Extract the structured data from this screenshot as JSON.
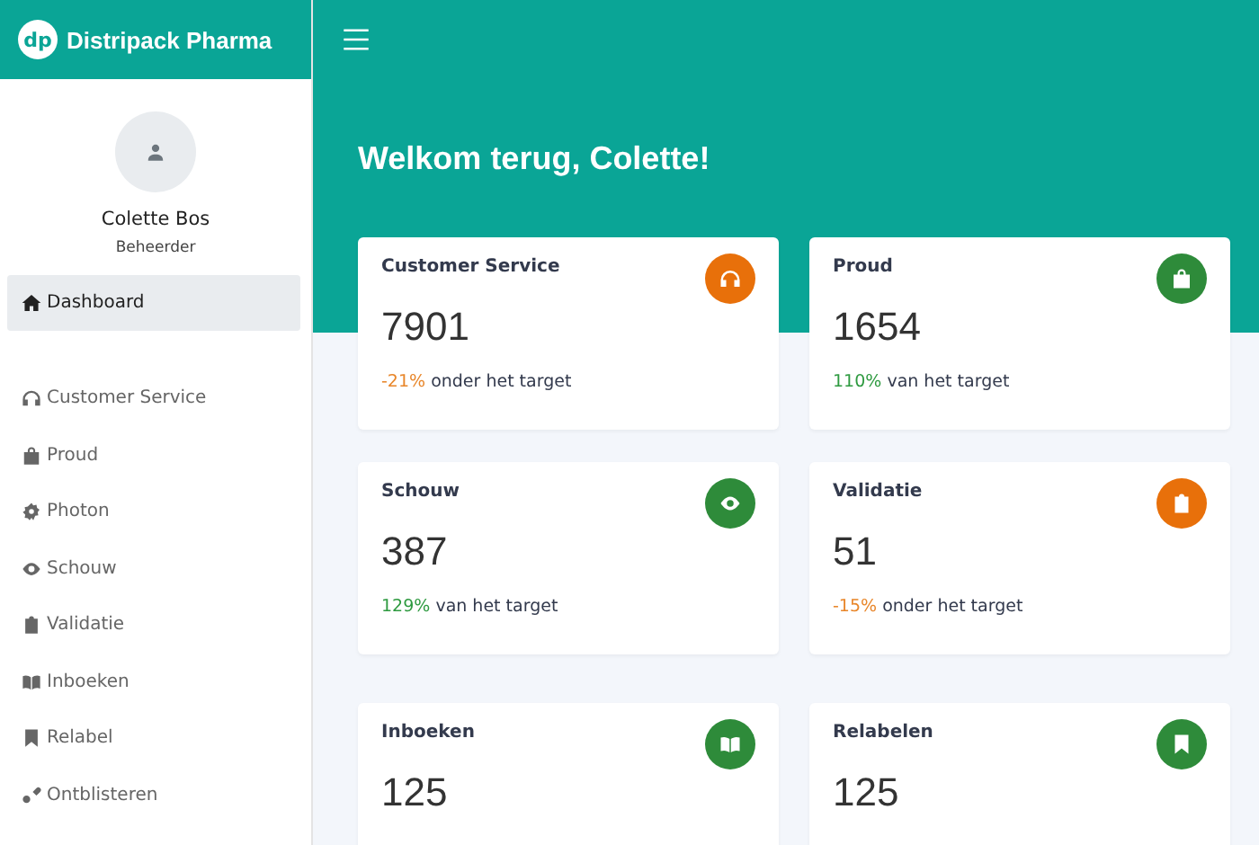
{
  "brand": {
    "logo": "dp",
    "name": "Distripack Pharma"
  },
  "user": {
    "name": "Colette Bos",
    "role": "Beheerder"
  },
  "sidebar": {
    "items": [
      {
        "label": "Dashboard",
        "selected": true
      },
      {
        "label": "Customer Service",
        "selected": false
      },
      {
        "label": "Proud",
        "selected": false
      },
      {
        "label": "Photon",
        "selected": false
      },
      {
        "label": "Schouw",
        "selected": false
      },
      {
        "label": "Validatie",
        "selected": false
      },
      {
        "label": "Inboeken",
        "selected": false
      },
      {
        "label": "Relabel",
        "selected": false
      },
      {
        "label": "Ontblisteren",
        "selected": false
      }
    ]
  },
  "welcome": "Welkom terug, Colette!",
  "cards": [
    {
      "title": "Customer Service",
      "value": "7901",
      "percent": "-21%",
      "note": "onder het target",
      "kind": "below",
      "color": "#e8700a"
    },
    {
      "title": "Proud",
      "value": "1654",
      "percent": "110%",
      "note": "van het target",
      "kind": "above",
      "color": "#2e8b3a"
    },
    {
      "title": "Schouw",
      "value": "387",
      "percent": "129%",
      "note": "van het target",
      "kind": "above",
      "color": "#2e8b3a"
    },
    {
      "title": "Validatie",
      "value": "51",
      "percent": "-15%",
      "note": "onder het target",
      "kind": "below",
      "color": "#e8700a"
    },
    {
      "title": "Inboeken",
      "value": "125",
      "color": "#2e8b3a"
    },
    {
      "title": "Relabelen",
      "value": "125",
      "color": "#2e8b3a"
    }
  ]
}
